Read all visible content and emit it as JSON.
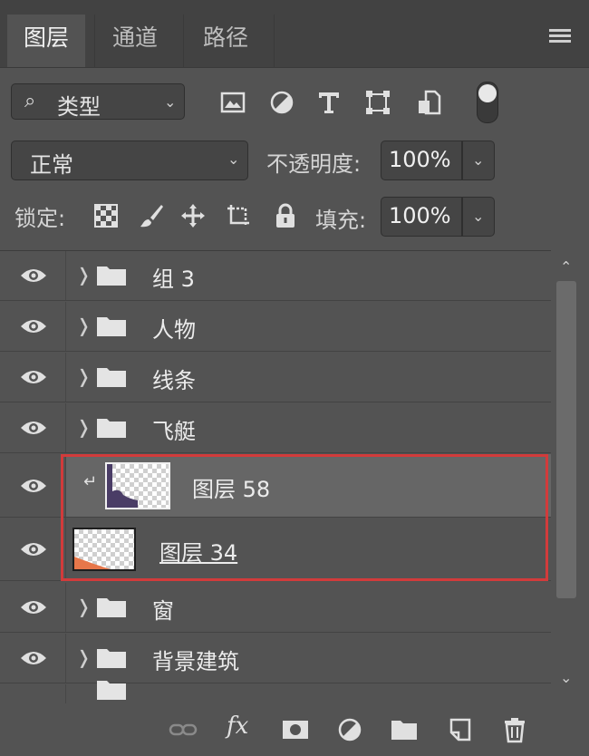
{
  "tabs": [
    {
      "label": "图层",
      "active": true
    },
    {
      "label": "通道",
      "active": false
    },
    {
      "label": "路径",
      "active": false
    }
  ],
  "filter": {
    "label": "类型",
    "icons": [
      "image-filter-icon",
      "adjustment-filter-icon",
      "type-filter-icon",
      "shape-filter-icon",
      "smart-object-filter-icon"
    ]
  },
  "blend_mode": "正常",
  "opacity": {
    "label": "不透明度:",
    "value": "100%"
  },
  "lock": {
    "label": "锁定:",
    "icons": [
      "lock-transparent-icon",
      "lock-image-icon",
      "lock-position-icon",
      "lock-artboard-icon",
      "lock-all-icon"
    ]
  },
  "fill": {
    "label": "填充:",
    "value": "100%"
  },
  "layers": [
    {
      "name": "组 3",
      "type": "group"
    },
    {
      "name": "人物",
      "type": "group"
    },
    {
      "name": "线条",
      "type": "group"
    },
    {
      "name": "飞艇",
      "type": "group"
    },
    {
      "name": "图层 58",
      "type": "clipped-layer",
      "selected": true
    },
    {
      "name": "图层 34",
      "type": "layer"
    },
    {
      "name": "窗",
      "type": "group"
    },
    {
      "name": "背景建筑",
      "type": "group"
    }
  ],
  "bottom_icons": [
    "link-icon",
    "fx-icon",
    "mask-icon",
    "adjustment-layer-icon",
    "new-group-icon",
    "new-layer-icon",
    "trash-icon"
  ],
  "bottom_fx_label": "fx",
  "colors": {
    "highlight": "#d23b3b",
    "panel": "#535353",
    "selected_row": "#666666"
  }
}
